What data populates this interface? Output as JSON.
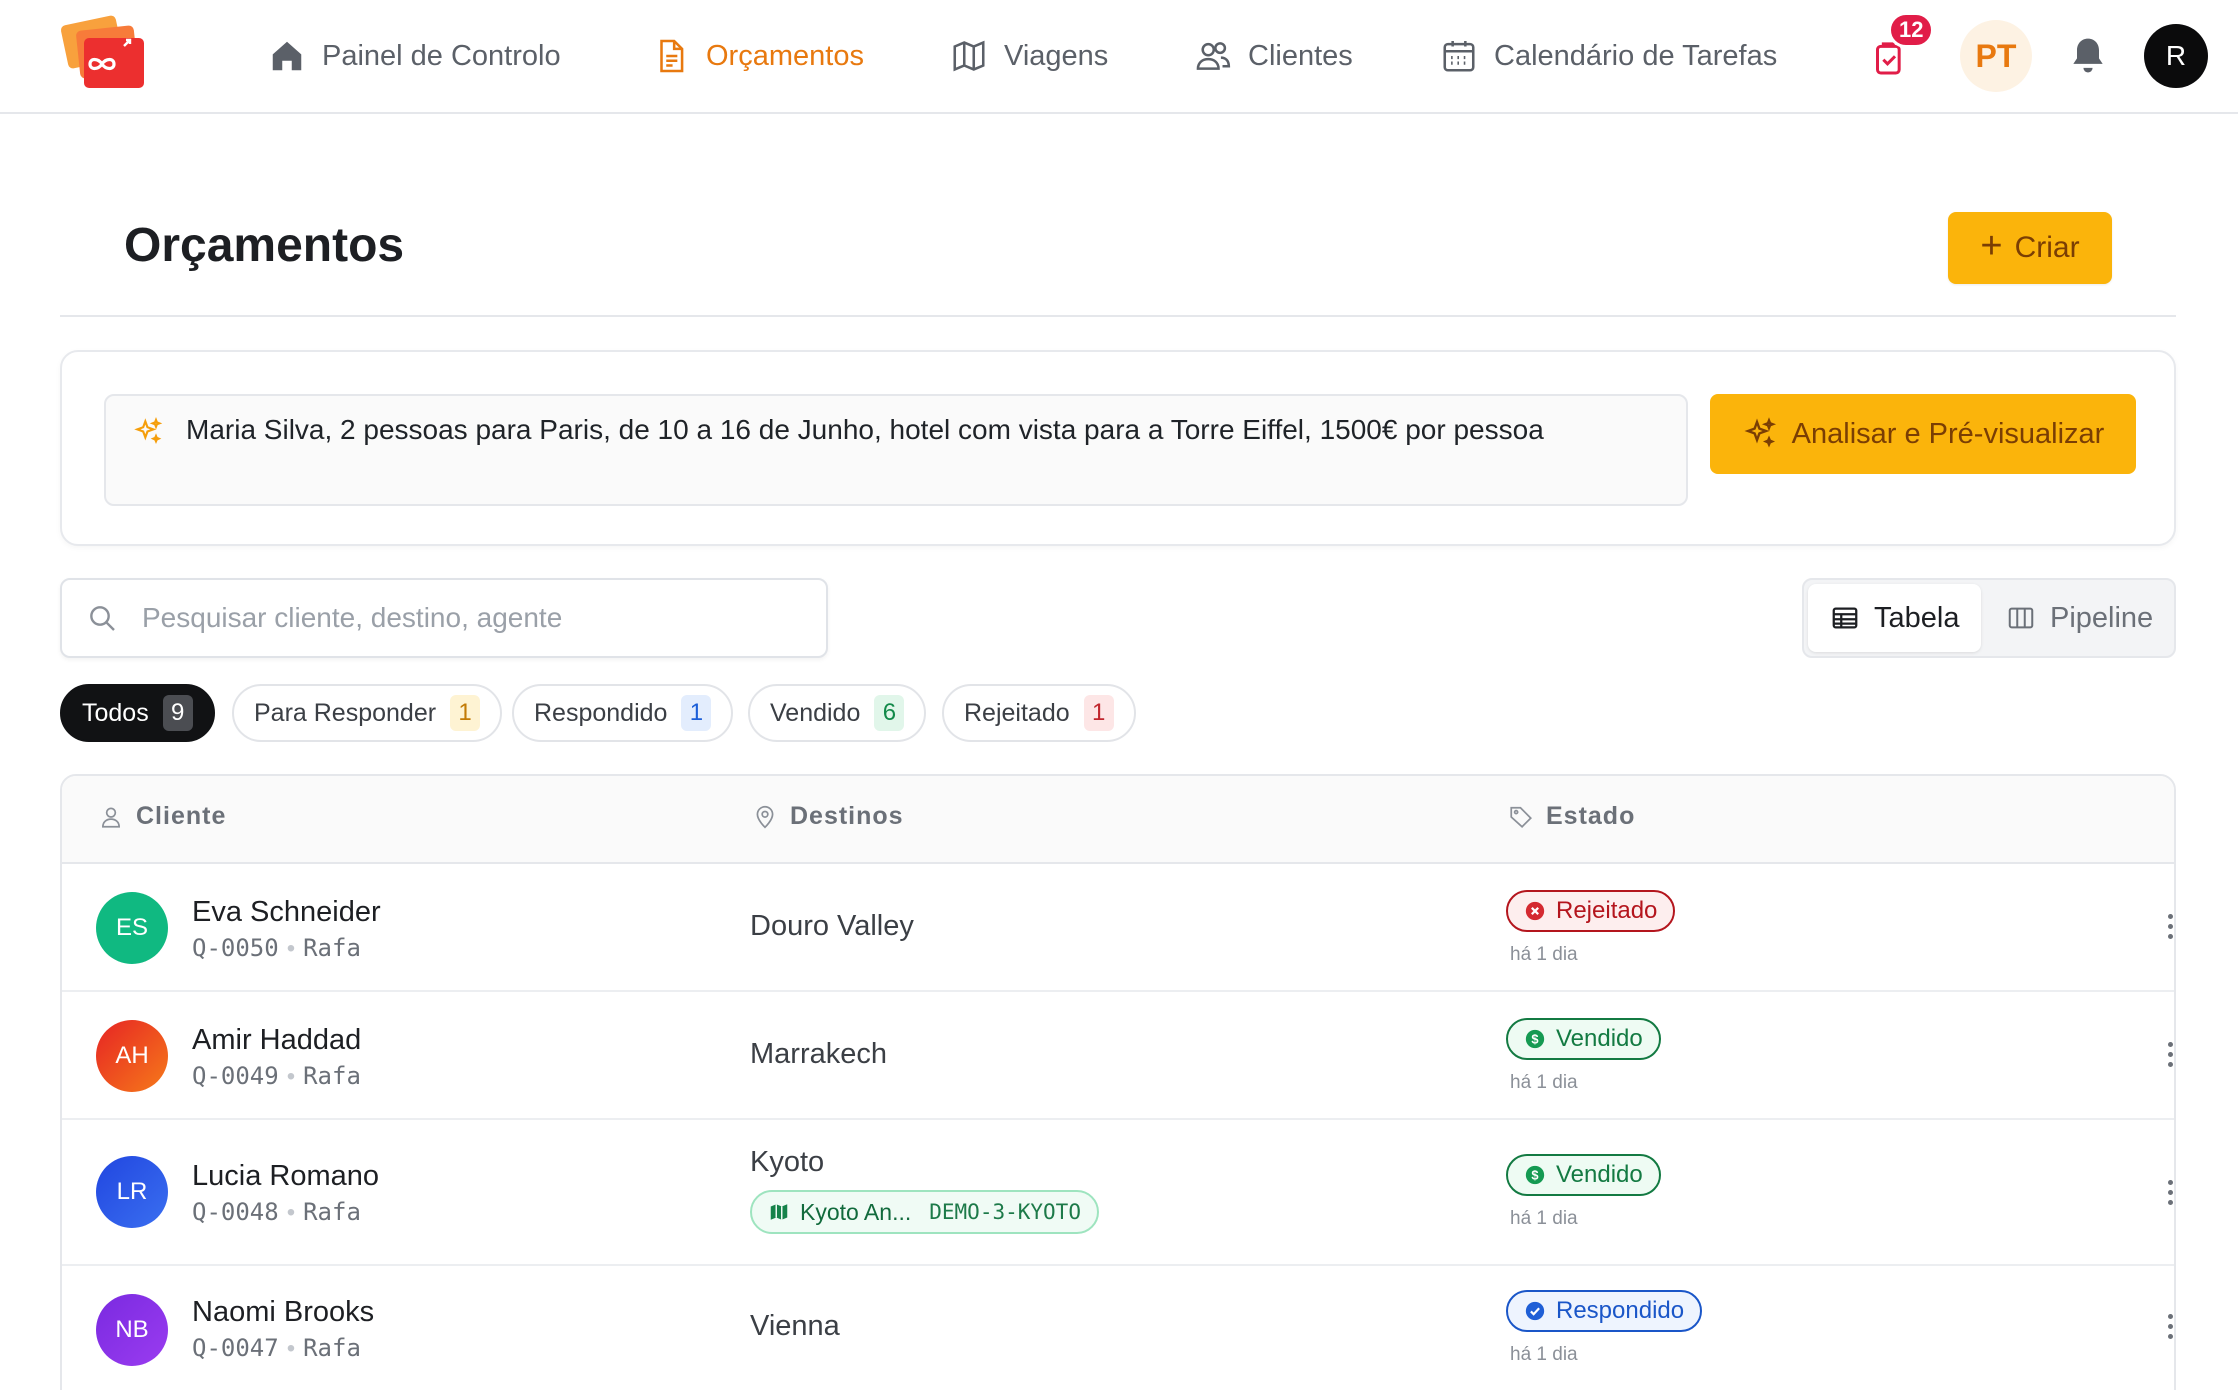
{
  "nav": {
    "items": [
      {
        "label": "Painel de Controlo",
        "icon": "home-icon"
      },
      {
        "label": "Orçamentos",
        "icon": "document-icon",
        "active": true
      },
      {
        "label": "Viagens",
        "icon": "map-icon"
      },
      {
        "label": "Clientes",
        "icon": "users-icon"
      },
      {
        "label": "Calendário de Tarefas",
        "icon": "calendar-icon"
      }
    ],
    "tasks_badge": "12",
    "language": "PT",
    "user_initial": "R",
    "accent_color": "#e8790f"
  },
  "page": {
    "title": "Orçamentos",
    "create_label": "Criar"
  },
  "ai": {
    "prompt_text": "Maria Silva, 2 pessoas para Paris, de 10 a 16 de Junho, hotel com vista para a Torre Eiffel, 1500€ por pessoa",
    "analyze_label": "Analisar e Pré-visualizar",
    "button_color": "#fbb40b"
  },
  "search": {
    "placeholder": "Pesquisar cliente, destino, agente"
  },
  "view_toggle": {
    "table_label": "Tabela",
    "pipeline_label": "Pipeline",
    "selected": "Tabela"
  },
  "filters": [
    {
      "label": "Todos",
      "count": "9",
      "active": true
    },
    {
      "label": "Para Responder",
      "count": "1"
    },
    {
      "label": "Respondido",
      "count": "1"
    },
    {
      "label": "Vendido",
      "count": "6"
    },
    {
      "label": "Rejeitado",
      "count": "1"
    }
  ],
  "table": {
    "headers": {
      "client": "Cliente",
      "destinations": "Destinos",
      "status": "Estado"
    },
    "rows": [
      {
        "initials": "ES",
        "avatar_color": "#10b981",
        "name": "Eva Schneider",
        "code": "Q-0050",
        "agent": "Rafa",
        "destination": "Douro Valley",
        "status": "Rejeitado",
        "status_kind": "rejected",
        "when": "há 1 dia"
      },
      {
        "initials": "AH",
        "avatar_color": "#f0441c",
        "name": "Amir Haddad",
        "code": "Q-0049",
        "agent": "Rafa",
        "destination": "Marrakech",
        "status": "Vendido",
        "status_kind": "sold",
        "when": "há 1 dia"
      },
      {
        "initials": "LR",
        "avatar_color": "#2b59e8",
        "name": "Lucia Romano",
        "code": "Q-0048",
        "agent": "Rafa",
        "destination": "Kyoto",
        "trip_label": "Kyoto An...",
        "trip_code": "DEMO-3-KYOTO",
        "status": "Vendido",
        "status_kind": "sold",
        "when": "há 1 dia"
      },
      {
        "initials": "NB",
        "avatar_color": "#8b32e6",
        "name": "Naomi Brooks",
        "code": "Q-0047",
        "agent": "Rafa",
        "destination": "Vienna",
        "status": "Respondido",
        "status_kind": "answered",
        "when": "há 1 dia"
      }
    ]
  }
}
